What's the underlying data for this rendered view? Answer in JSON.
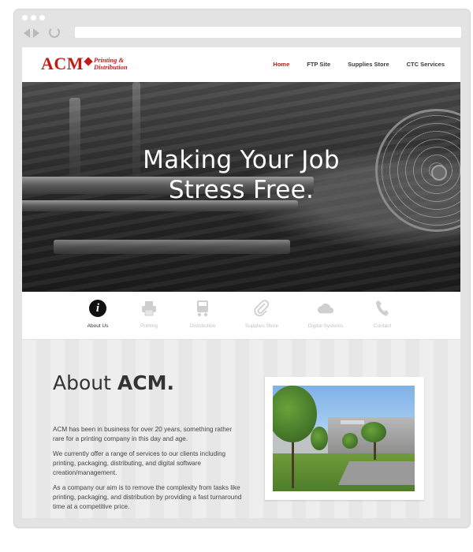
{
  "brand": {
    "name": "ACM",
    "tagline_line1": "Printing &",
    "tagline_line2": "Distribution",
    "color": "#c21b17"
  },
  "nav": {
    "items": [
      {
        "label": "Home",
        "active": true
      },
      {
        "label": "FTP Site",
        "active": false
      },
      {
        "label": "Supplies Store",
        "active": false
      },
      {
        "label": "CTC Services",
        "active": false
      }
    ]
  },
  "hero": {
    "title_line1": "Making Your Job",
    "title_line2": "Stress Free."
  },
  "services": [
    {
      "label": "About Us",
      "icon": "info-icon",
      "active": true
    },
    {
      "label": "Printing",
      "icon": "printer-icon",
      "active": false
    },
    {
      "label": "Distribution",
      "icon": "truck-icon",
      "active": false
    },
    {
      "label": "Supplies Store",
      "icon": "paperclip-icon",
      "active": false
    },
    {
      "label": "Digital Systems",
      "icon": "cloud-icon",
      "active": false
    },
    {
      "label": "Contact",
      "icon": "phone-icon",
      "active": false
    }
  ],
  "about": {
    "title_prefix": "About ",
    "title_bold": "ACM.",
    "paragraphs": [
      "ACM has been in business for over 20 years, something rather rare for a printing company in this day and age.",
      "We currently offer a range of services to our clients including printing, packaging, distributing, and digital software creation/management.",
      "As a company our aim is to remove the complexity from tasks like printing, packaging, and distribution by providing a fast turnaround time at a competitive price."
    ]
  }
}
